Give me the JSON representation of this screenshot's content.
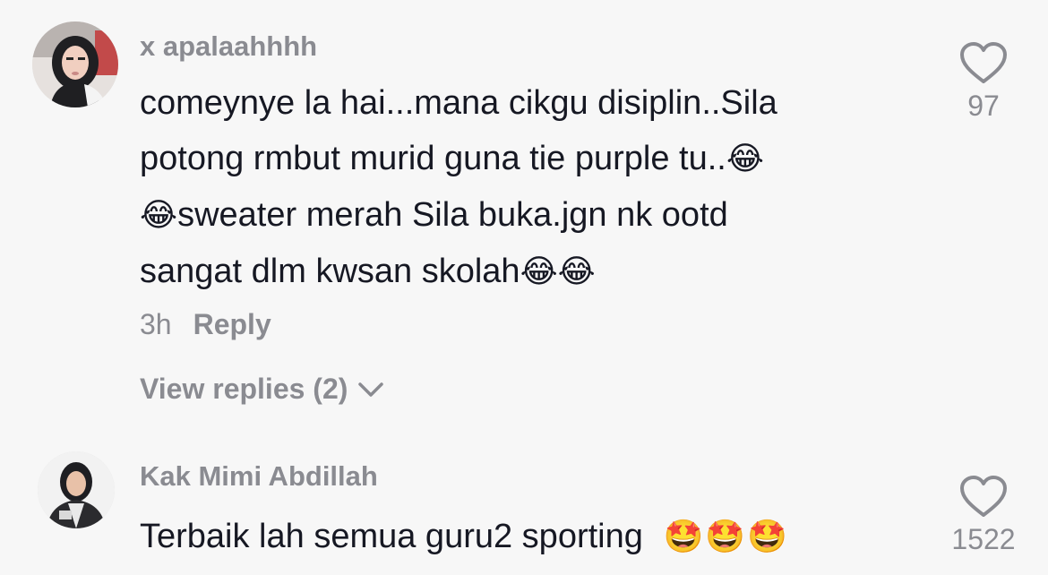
{
  "comments": [
    {
      "username": "x apalaahhhh",
      "lines": [
        "comeynye la hai...mana cikgu disiplin..Sila",
        "potong rmbut murid guna tie purple tu..",
        "sweater merah Sila buka.jgn nk ootd",
        "sangat dlm kwsan skolah"
      ],
      "emoji_laugh": "😂",
      "time": "3h",
      "reply_label": "Reply",
      "view_replies": "View replies (2)",
      "likes": "97"
    },
    {
      "username": "Kak Mimi Abdillah",
      "text": "Terbaik lah semua guru2 sporting ",
      "emojis": "🤩🤩🤩",
      "likes": "1522"
    }
  ],
  "colors": {
    "text": "#161823",
    "muted": "#8a8b91",
    "background": "#f7f7f7"
  },
  "icons": {
    "like": "heart-icon",
    "expand": "chevron-down-icon"
  }
}
